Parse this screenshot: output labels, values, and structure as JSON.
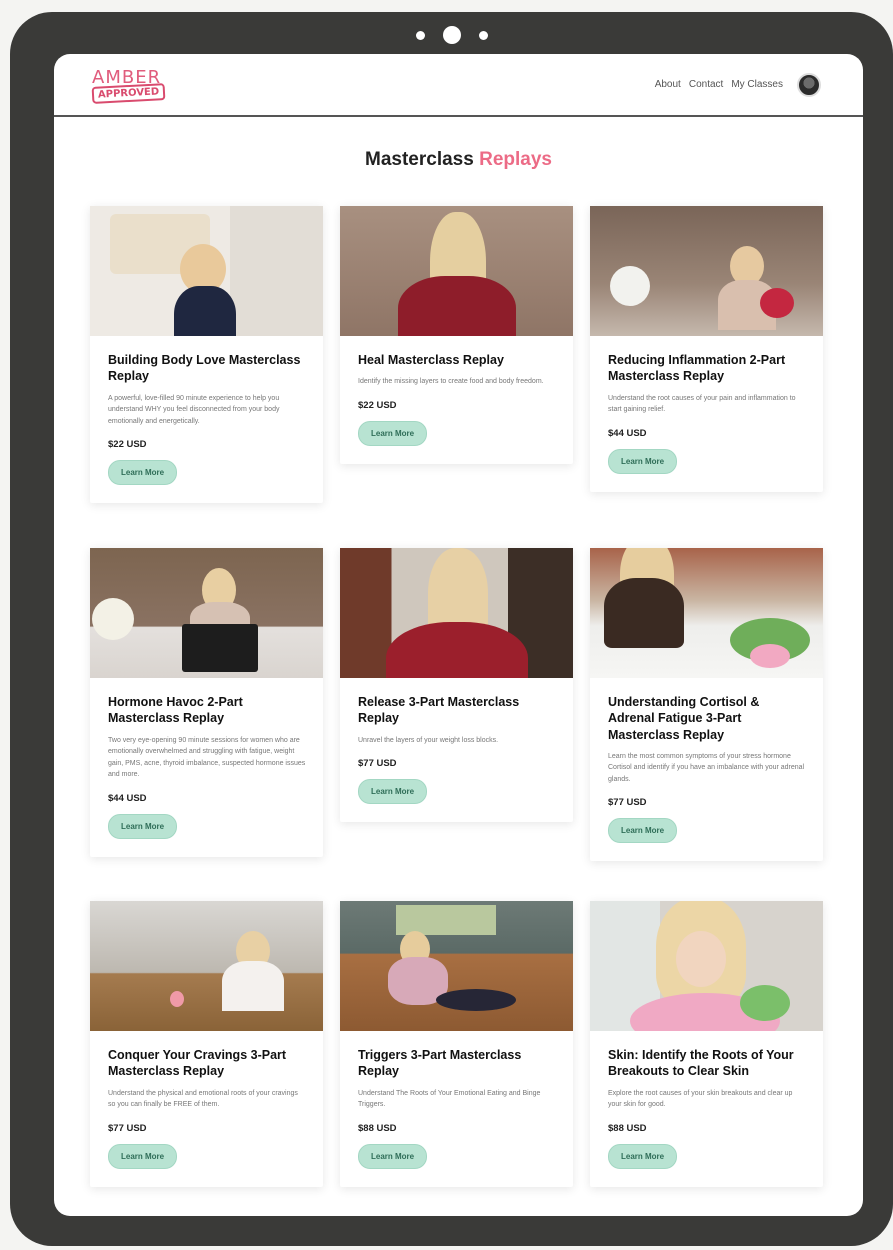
{
  "header": {
    "logo_top": "AMBER",
    "logo_bottom": "APPROVED",
    "nav": [
      "About",
      "Contact",
      "My Classes"
    ]
  },
  "page": {
    "title_main": "Masterclass",
    "title_accent": "Replays"
  },
  "colors": {
    "accent": "#ec6b86",
    "button_bg": "#b8e3d2",
    "button_text": "#2f6e58",
    "frame": "#3a3a38"
  },
  "cards": [
    {
      "title": "Building Body Love Masterclass Replay",
      "desc": "A powerful, love-filled 90 minute experience to help you understand WHY you feel disconnected from your body emotionally and energetically.",
      "price": "$22 USD",
      "button": "Learn More"
    },
    {
      "title": "Heal Masterclass Replay",
      "desc": "Identify the missing layers to create food and body freedom.",
      "price": "$22 USD",
      "button": "Learn More"
    },
    {
      "title": "Reducing Inflammation 2-Part Masterclass Replay",
      "desc": "Understand the root causes of your pain and inflammation to start gaining relief.",
      "price": "$44 USD",
      "button": "Learn More"
    },
    {
      "title": "Hormone Havoc 2-Part Masterclass Replay",
      "desc": "Two very eye-opening 90 minute sessions for women who are emotionally overwhelmed and struggling with fatigue, weight gain, PMS, acne, thyroid imbalance, suspected hormone issues and more.",
      "price": "$44 USD",
      "button": "Learn More"
    },
    {
      "title": "Release 3-Part Masterclass Replay",
      "desc": "Unravel the layers of your weight loss blocks.",
      "price": "$77 USD",
      "button": "Learn More"
    },
    {
      "title": "Understanding Cortisol & Adrenal Fatigue 3-Part Masterclass Replay",
      "desc": "Learn the most common symptoms of your stress hormone Cortisol and identify if you have an imbalance with your adrenal glands.",
      "price": "$77 USD",
      "button": "Learn More"
    },
    {
      "title": "Conquer Your Cravings 3-Part Masterclass Replay",
      "desc": "Understand the physical and emotional roots of your cravings so you can finally be FREE of them.",
      "price": "$77 USD",
      "button": "Learn More"
    },
    {
      "title": "Triggers 3-Part Masterclass Replay",
      "desc": "Understand The Roots of Your Emotional Eating and Binge Triggers.",
      "price": "$88 USD",
      "button": "Learn More"
    },
    {
      "title": "Skin: Identify the Roots of Your Breakouts to Clear Skin",
      "desc": "Explore the root causes of your skin breakouts and clear up your skin for good.",
      "price": "$88 USD",
      "button": "Learn More"
    }
  ]
}
